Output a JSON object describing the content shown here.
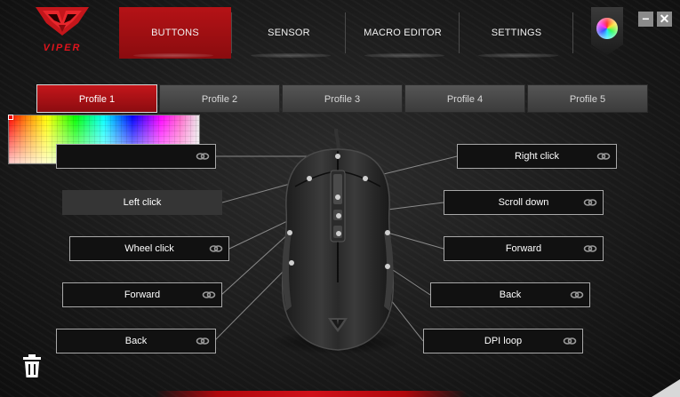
{
  "app": {
    "logo_text": "VIPER",
    "brand_color": "#c4161b"
  },
  "tabs": [
    {
      "label": "BUTTONS",
      "active": true
    },
    {
      "label": "SENSOR",
      "active": false
    },
    {
      "label": "MACRO EDITOR",
      "active": false
    },
    {
      "label": "SETTINGS",
      "active": false
    }
  ],
  "window_controls": {
    "minimize_label": "−",
    "close_label": "✕",
    "color_orb_icon": "rgb-color-orb-icon"
  },
  "profiles": [
    {
      "label": "Profile 1",
      "active": true
    },
    {
      "label": "Profile 2",
      "active": false
    },
    {
      "label": "Profile 3",
      "active": false
    },
    {
      "label": "Profile 4",
      "active": false
    },
    {
      "label": "Profile 5",
      "active": false
    }
  ],
  "button_assignments": {
    "left": [
      {
        "label": "",
        "icon": "link-icon"
      },
      {
        "label": "Left click",
        "icon": ""
      },
      {
        "label": "Wheel click",
        "icon": "link-icon"
      },
      {
        "label": "Forward",
        "icon": "link-icon"
      },
      {
        "label": "Back",
        "icon": "link-icon"
      }
    ],
    "right": [
      {
        "label": "Right click",
        "icon": "link-icon"
      },
      {
        "label": "Scroll down",
        "icon": "link-icon"
      },
      {
        "label": "Forward",
        "icon": "link-icon"
      },
      {
        "label": "Back",
        "icon": "link-icon"
      },
      {
        "label": "DPI loop",
        "icon": "link-icon"
      }
    ]
  },
  "footer": {
    "trash_icon": "trash-icon"
  }
}
